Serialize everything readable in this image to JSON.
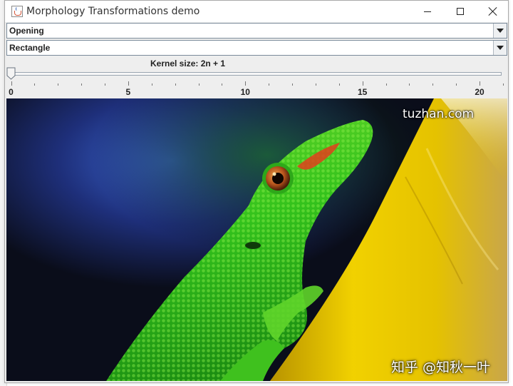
{
  "window": {
    "title": "Morphology Transformations demo"
  },
  "controls": {
    "operation": {
      "selected": "Opening"
    },
    "element": {
      "selected": "Rectangle"
    }
  },
  "slider": {
    "label": "Kernel size: 2n + 1",
    "min": 0,
    "max": 21,
    "value": 0,
    "major_labels": [
      "0",
      "5",
      "10",
      "15",
      "20"
    ]
  },
  "image": {
    "description_icon": "gecko-photo",
    "watermark_top": "tuzhan.com",
    "watermark_bottom": "知乎 @知秋一叶"
  },
  "colors": {
    "accent_border": "#7a8a9a",
    "lizard_green": "#3cc81e",
    "bamboo_yellow": "#e3c300"
  }
}
